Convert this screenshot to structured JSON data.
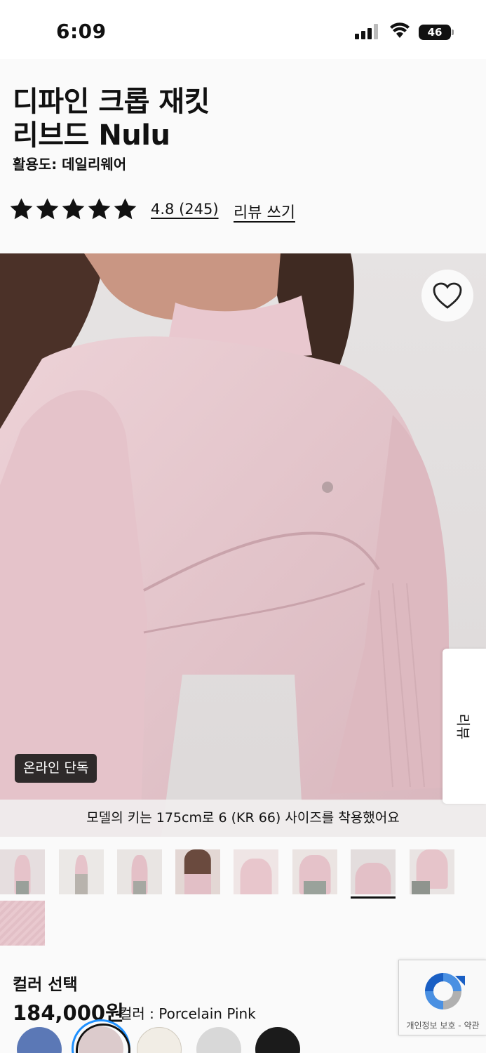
{
  "status_bar": {
    "time": "6:09",
    "battery": "46"
  },
  "product": {
    "title_line1": "디파인 크롭 재킷",
    "title_line2": "리브드 Nulu",
    "activity": "활용도: 데일리웨어",
    "rating_text": "4.8 (245)",
    "rating_value": 4.8,
    "review_write": "리뷰 쓰기"
  },
  "hero": {
    "badge": "온라인 단독",
    "model_info": "모델의 키는 175cm로 6 (KR 66) 사이즈를 착용했어요",
    "review_tab": "리뷰"
  },
  "thumbnails": {
    "count": 9,
    "selected_index": 6
  },
  "color_section": {
    "title": "컬러 선택",
    "price": "184,000원",
    "color_label": "컬러 : Porcelain Pink",
    "swatches": [
      {
        "name": "blue",
        "color": "#5b78b6"
      },
      {
        "name": "porcelain-pink",
        "color": "#dccbcc",
        "selected": true
      },
      {
        "name": "cream",
        "color": "#f1ede5"
      },
      {
        "name": "light-grey",
        "color": "#d8d8d8"
      },
      {
        "name": "black",
        "color": "#1b1b1b"
      }
    ]
  },
  "recaptcha": {
    "text": "개인정보 보호 - 약관"
  },
  "colors": {
    "jacket_pink": "#e8c8ce",
    "accent_blue": "#1e90ff"
  }
}
